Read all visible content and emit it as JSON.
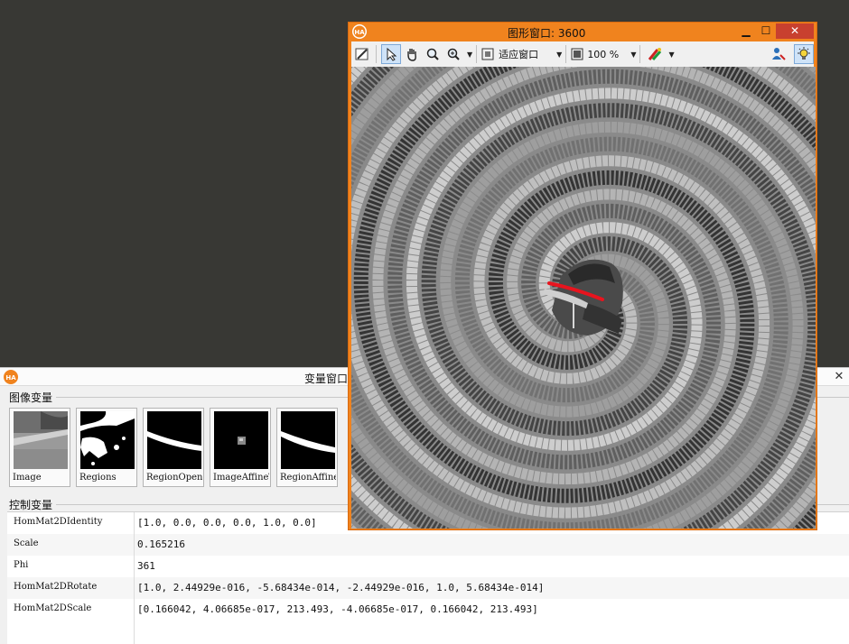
{
  "graphics_window": {
    "title": "图形窗口: 3600",
    "logo_text": "HA",
    "toolbar": {
      "zoom_mode": "适应窗口",
      "zoom_percent": "100 %"
    }
  },
  "variable_window": {
    "title": "变量窗口",
    "logo_text": "HA",
    "image_group_label": "图像变量",
    "control_group_label": "控制变量",
    "images": [
      {
        "label": "Image"
      },
      {
        "label": "Regions"
      },
      {
        "label": "RegionOpening"
      },
      {
        "label": "ImageAffineTrans"
      },
      {
        "label": "RegionAffineTrans"
      }
    ],
    "controls": [
      {
        "name": "HomMat2DIdentity",
        "value": "[1.0, 0.0, 0.0, 0.0, 1.0, 0.0]"
      },
      {
        "name": "Scale",
        "value": "0.165216"
      },
      {
        "name": "Phi",
        "value": "361"
      },
      {
        "name": "HomMat2DRotate",
        "value": "[1.0, 2.44929e-016, -5.68434e-014, -2.44929e-016, 1.0, 5.68434e-014]"
      },
      {
        "name": "HomMat2DScale",
        "value": "[0.166042, 4.06685e-017, 213.493, -4.06685e-017, 0.166042, 213.493]"
      }
    ]
  },
  "colors": {
    "desktop": "#383834",
    "graphics_frame": "#f0831e",
    "close_button": "#c8402f",
    "region_overlay": "#e8141e"
  }
}
